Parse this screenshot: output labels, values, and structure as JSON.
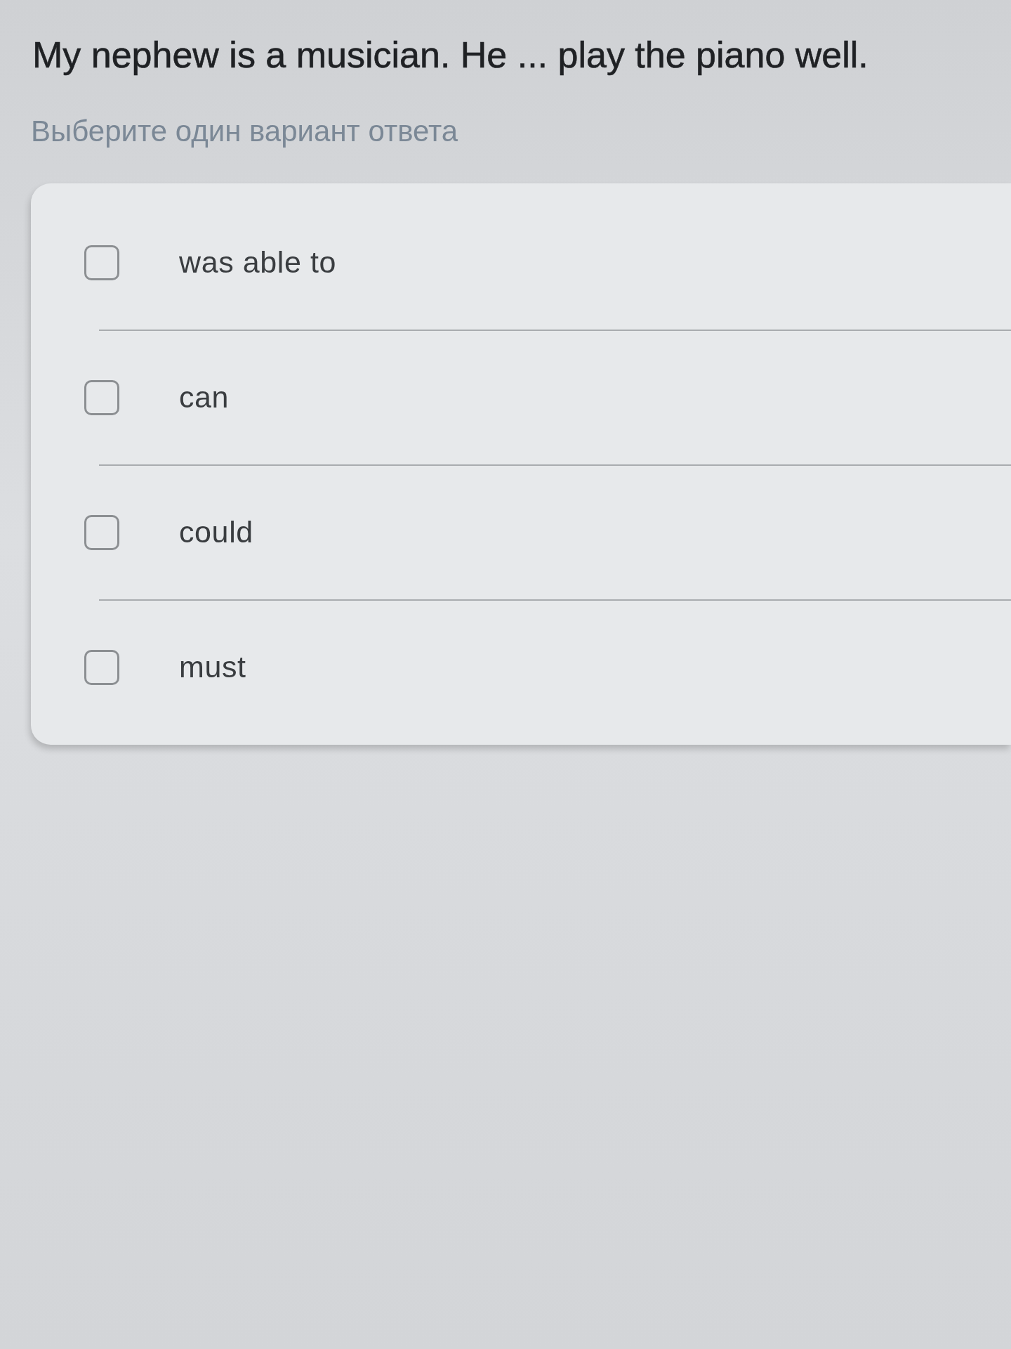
{
  "question": {
    "text": "My nephew is a musician. He ... play the piano well."
  },
  "instruction": "Выберите один вариант ответа",
  "options": [
    {
      "label": "was able to",
      "checked": false
    },
    {
      "label": "can",
      "checked": false
    },
    {
      "label": "could",
      "checked": false
    },
    {
      "label": "must",
      "checked": false
    }
  ]
}
